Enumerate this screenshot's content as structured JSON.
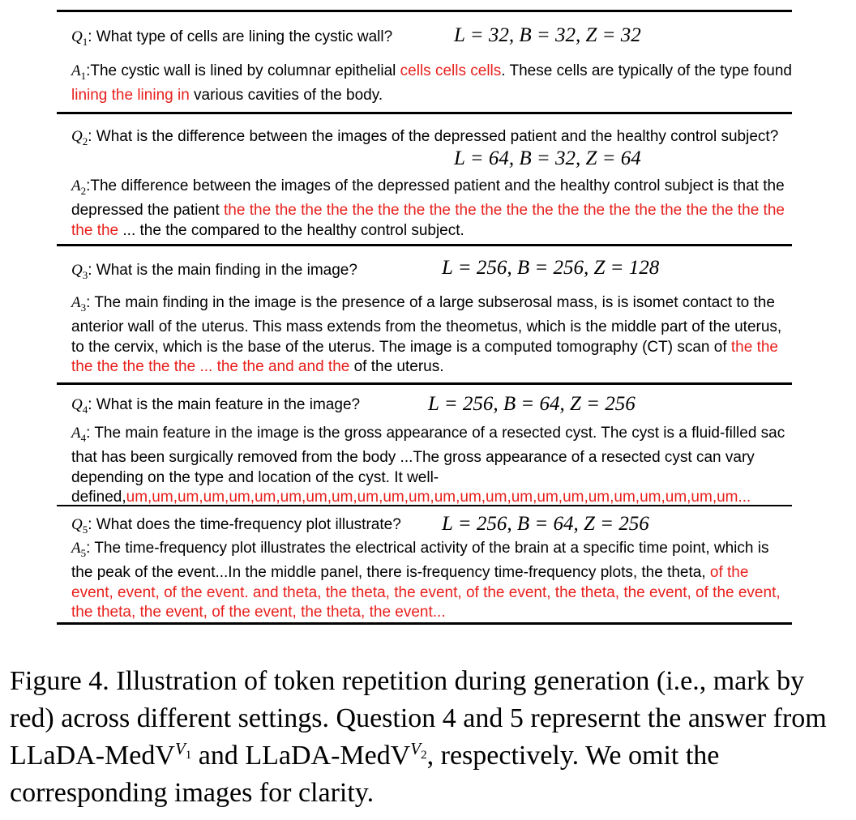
{
  "blocks": [
    {
      "q_label": "Q",
      "q_num": "1",
      "question": ": What type of cells are lining the cystic wall?",
      "params": "L = 32, B = 32, Z = 32",
      "a_label": "A",
      "a_num": "1",
      "answer": [
        {
          "t": ":The cystic wall is lined by columnar epithelial ",
          "red": false
        },
        {
          "t": "cells cells cells",
          "red": true
        },
        {
          "t": ". These cells are typically of the type found ",
          "red": false
        },
        {
          "t": "lining the lining in",
          "red": true
        },
        {
          "t": " various cavities of the body.",
          "red": false
        }
      ]
    },
    {
      "q_label": "Q",
      "q_num": "2",
      "question": ": What is the difference between the images of the depressed patient and the healthy control subject?",
      "params": "L = 64, B = 32, Z = 64",
      "a_label": "A",
      "a_num": "2",
      "answer": [
        {
          "t": ":The difference between the images of the depressed patient and the healthy control subject is that the depressed the patient ",
          "red": false
        },
        {
          "t": "the the the the the the the the the the the the the the the the the the the the the the the the",
          "red": true
        },
        {
          "t": " ... the the compared to the healthy control subject.",
          "red": false
        }
      ]
    },
    {
      "q_label": "Q",
      "q_num": "3",
      "question": ": What is the main finding in the image?",
      "params": "L = 256, B = 256, Z = 128",
      "a_label": "A",
      "a_num": "3",
      "answer": [
        {
          "t": ": The main finding in the image is the presence of a large subserosal mass, is is isomet contact to the anterior wall of the uterus. This mass extends from the theometus, which is the middle part of the uterus, to the cervix, which is the base of the uterus. The image is a computed tomography (CT) scan of ",
          "red": false
        },
        {
          "t": "the the the the the the the ... the the and and the",
          "red": true
        },
        {
          "t": " of the uterus.",
          "red": false
        }
      ]
    },
    {
      "q_label": "Q",
      "q_num": "4",
      "question": ": What is the main feature in the image?",
      "params": "L = 256, B = 64, Z = 256",
      "a_label": "A",
      "a_num": "4",
      "answer": [
        {
          "t": ": The main feature in the image is the gross appearance of a resected cyst. The cyst is a fluid-filled sac that has been surgically removed from the body ...The gross appearance of a resected cyst can vary depending on the type and location of the cyst. It well-defined,",
          "red": false
        },
        {
          "t": "um,um,um,um,um,um,um,um,um,um,um,um,um,um,um,um,um,um,um,um,um,um,um,um...",
          "red": true
        }
      ]
    },
    {
      "q_label": "Q",
      "q_num": "5",
      "question": ": What does the time-frequency plot illustrate?",
      "params": "L = 256, B = 64, Z = 256",
      "a_label": "A",
      "a_num": "5",
      "answer": [
        {
          "t": ": The time-frequency plot illustrates the electrical activity of the brain at a specific time point, which is the peak of the event...In the middle panel, there is-frequency time-frequency plots, the theta, ",
          "red": false
        },
        {
          "t": "of the event, event, of the event. and theta, the theta, the event, of the event, the theta, the event, of the event, the theta, the event, of the event, the theta, the event...",
          "red": true
        }
      ]
    }
  ],
  "caption": {
    "before": "Figure 4. Illustration of token repetition during generation (i.e., mark by red) across different settings. Question 4 and 5 represernt the answer from LLaDA-MedV",
    "sup1_base": "V",
    "sup1_sub": "1",
    "middle": " and LLaDA-MedV",
    "sup2_base": "V",
    "sup2_sub": "2",
    "after": ", respectively. We omit the corresponding images for clarity."
  },
  "colors": {
    "highlight": "#e8201c",
    "text": "#000000"
  }
}
